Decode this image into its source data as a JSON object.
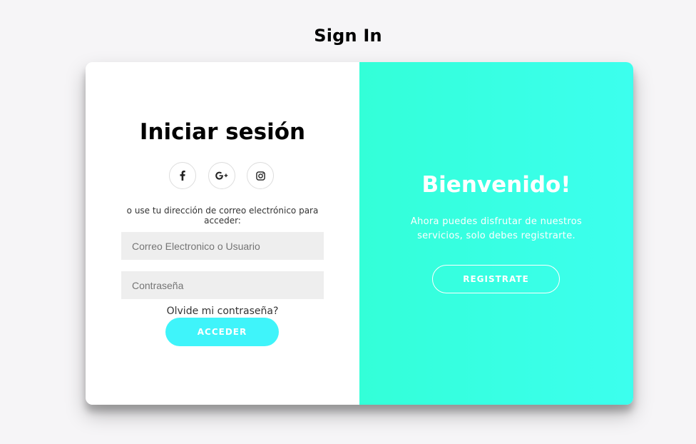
{
  "page": {
    "title": "Sign In"
  },
  "login": {
    "heading": "Iniciar sesión",
    "social": [
      {
        "icon": "facebook-icon"
      },
      {
        "icon": "google-plus-icon"
      },
      {
        "icon": "instagram-icon"
      }
    ],
    "hint": "o use tu dirección de correo electrónico para acceder:",
    "email_placeholder": "Correo Electronico o Usuario",
    "password_placeholder": "Contraseña",
    "forgot_label": "Olvide mi contraseña?",
    "submit_label": "ACCEDER"
  },
  "welcome": {
    "title": "Bienvenido!",
    "text": "Ahora puedes disfrutar de nuestros servicios, solo debes registrarte.",
    "register_label": "REGISTRATE"
  },
  "colors": {
    "accent": "#3ff4fa",
    "panel_gradient_start": "#33ffd8",
    "panel_gradient_end": "#3cffee",
    "field_background": "#eeeeee"
  }
}
